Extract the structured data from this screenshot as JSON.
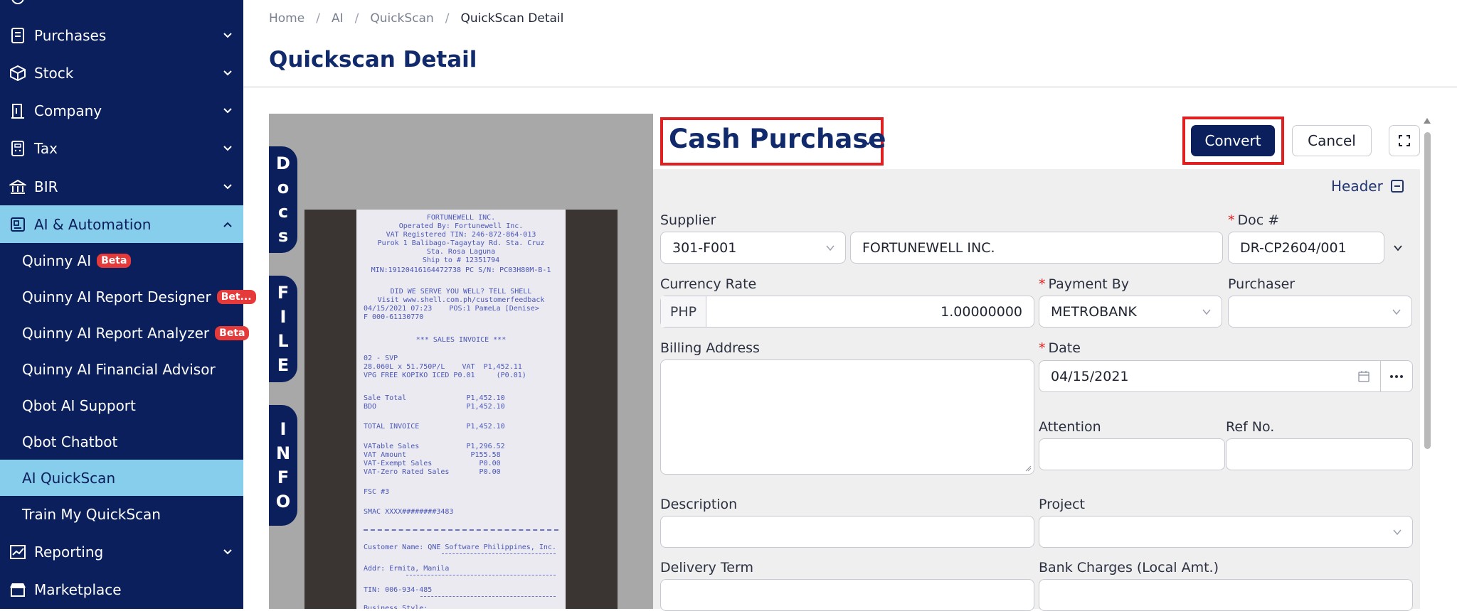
{
  "sidebar": {
    "items": [
      {
        "label": "Purchases",
        "icon": "purchases-icon"
      },
      {
        "label": "Stock",
        "icon": "box-icon"
      },
      {
        "label": "Company",
        "icon": "building-icon"
      },
      {
        "label": "Tax",
        "icon": "tax-icon"
      },
      {
        "label": "BIR",
        "icon": "bir-icon"
      },
      {
        "label": "AI & Automation",
        "icon": "ai-icon"
      },
      {
        "label": "Reporting",
        "icon": "chart-icon"
      },
      {
        "label": "Marketplace",
        "icon": "store-icon"
      }
    ],
    "sub_items": [
      {
        "label": "Quinny AI",
        "badge": "Beta"
      },
      {
        "label": "Quinny AI Report Designer",
        "badge": "Bet..."
      },
      {
        "label": "Quinny AI Report Analyzer",
        "badge": "Beta"
      },
      {
        "label": "Quinny AI Financial Advisor"
      },
      {
        "label": "Qbot AI Support"
      },
      {
        "label": "Qbot Chatbot"
      },
      {
        "label": "AI QuickScan"
      },
      {
        "label": "Train My QuickScan"
      }
    ]
  },
  "breadcrumb": [
    "Home",
    "AI",
    "QuickScan",
    "QuickScan Detail"
  ],
  "page_title": "Quickscan Detail",
  "viewer": {
    "tabs": [
      "Docs",
      "FILE",
      "INFO"
    ],
    "receipt_lines": [
      "FORTUNEWELL INC.",
      "Operated By: Fortunewell Inc.",
      "VAT Registered TIN: 246-872-864-013",
      "Purok 1 Balibago-Tagaytay Rd. Sta. Cruz",
      "Sta. Rosa Laguna",
      "Ship to # 12351794",
      "MIN:19120416164472738 PC S/N: PC03H80M-B-1",
      "DID WE SERVE YOU WELL? TELL SHELL",
      "Visit www.shell.com.ph/customerfeedback",
      "04/15/2021 07:23    POS:1 PameLa [Denise>",
      "F 000-61130770",
      "*** SALES INVOICE ***",
      "02 - SVP",
      "28.060L x 51.750P/L    VAT  P1,452.11",
      "VPG FREE KOPIKO ICED P0.01     (P0.01)",
      "Sale Total              P1,452.10",
      "BDO                     P1,452.10",
      "TOTAL INVOICE           P1,452.10",
      "VATable Sales           P1,296.52",
      "VAT Amount               P155.58",
      "VAT-Exempt Sales           P0.00",
      "VAT-Zero Rated Sales       P0.00",
      "FSC #3",
      "SMAC XXXX########3483",
      "Customer Name: QNE Software Philippines, Inc.",
      "Addr: Ermita, Manila",
      "TIN: 006-934-485",
      "Business Style:"
    ]
  },
  "form": {
    "doc_type": "Cash Purchase",
    "convert_label": "Convert",
    "cancel_label": "Cancel",
    "header_label": "Header",
    "supplier_label": "Supplier",
    "supplier_code": "301-F001",
    "supplier_name": "FORTUNEWELL INC.",
    "docno_label": "Doc #",
    "docno_value": "DR-CP2604/001",
    "currency_label": "Currency Rate",
    "currency_code": "PHP",
    "currency_rate": "1.00000000",
    "payment_label": "Payment By",
    "payment_value": "METROBANK",
    "purchaser_label": "Purchaser",
    "purchaser_value": "",
    "billing_label": "Billing Address",
    "date_label": "Date",
    "date_value": "04/15/2021",
    "attention_label": "Attention",
    "refno_label": "Ref No.",
    "description_label": "Description",
    "project_label": "Project",
    "delivery_label": "Delivery Term",
    "bank_charges_label": "Bank Charges (Local Amt.)"
  },
  "colors": {
    "sidebar": "#0a1f5c",
    "active": "#87cdec",
    "highlight": "#e02020",
    "primary": "#0a1f5c"
  }
}
